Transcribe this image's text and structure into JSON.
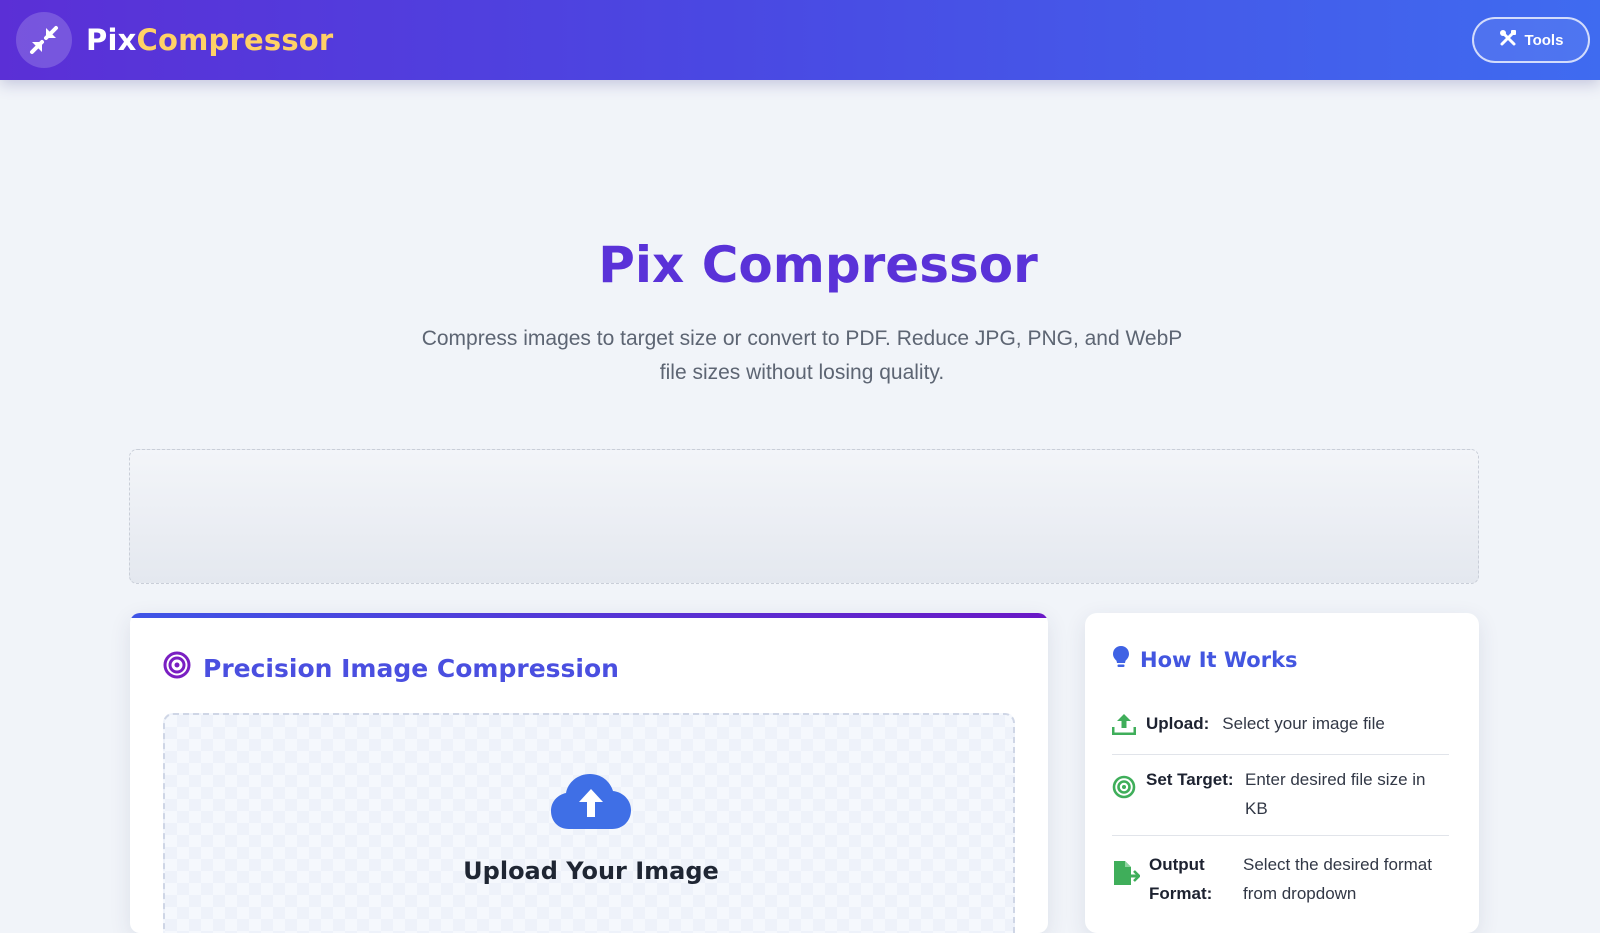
{
  "header": {
    "logo_part1": "Pix",
    "logo_part2": "Compressor",
    "tools_label": "Tools",
    "logo_icon": "compress-arrows-icon",
    "tools_icon": "tools-icon"
  },
  "hero": {
    "title": "Pix Compressor",
    "subtitle": "Compress images to target size or convert to PDF. Reduce JPG, PNG, and WebP file sizes without losing quality."
  },
  "main_card": {
    "title": "Precision Image Compression",
    "title_icon": "target-icon",
    "upload_title": "Upload Your Image",
    "upload_icon": "cloud-upload-icon"
  },
  "how_it_works": {
    "title": "How It Works",
    "title_icon": "lightbulb-icon",
    "steps": [
      {
        "label": "Upload:",
        "description": "Select your image file",
        "icon": "upload-icon"
      },
      {
        "label": "Set Target:",
        "description": "Enter desired file size in KB",
        "icon": "target-icon"
      },
      {
        "label": "Output Format:",
        "description": "Select the desired format from dropdown",
        "icon": "file-export-icon"
      }
    ]
  },
  "colors": {
    "brand_gradient_start": "#5b2fd6",
    "brand_gradient_end": "#3f6bf0",
    "logo_accent": "#ffd166",
    "heading_purple": "#5a32d8",
    "heading_blue": "#4a4fe0",
    "step_icon_green": "#3fae5a"
  }
}
